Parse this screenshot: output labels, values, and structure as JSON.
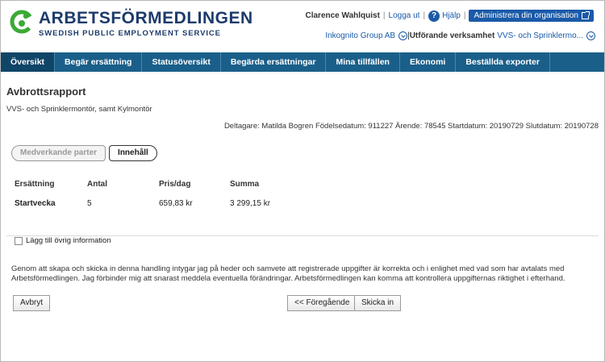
{
  "header": {
    "logo": {
      "name": "ARBETSFÖRMEDLINGEN",
      "subtitle": "SWEDISH PUBLIC EMPLOYMENT SERVICE"
    },
    "user_name": "Clarence Wahlquist",
    "logout": "Logga ut",
    "help": "Hjälp",
    "admin_button": "Administrera din organisation",
    "org_name": "Inkognito Group AB",
    "activity_label": "Utförande verksamhet",
    "activity_value": "VVS- och Sprinklermo..."
  },
  "nav": {
    "items": [
      "Översikt",
      "Begär ersättning",
      "Statusöversikt",
      "Begärda ersättningar",
      "Mina tillfällen",
      "Ekonomi",
      "Beställda exporter"
    ],
    "active_index": 0
  },
  "page": {
    "title": "Avbrottsrapport",
    "subtitle": "VVS- och Sprinklermontör, samt Kylmontör",
    "participant_info": "Deltagare: Matilda Bogren Födelsedatum: 911227 Ärende: 78545 Startdatum: 20190729 Slutdatum: 20190728"
  },
  "steps": {
    "previous": "Medverkande parter",
    "current": "Innehåll"
  },
  "table": {
    "headers": [
      "Ersättning",
      "Antal",
      "Pris/dag",
      "Summa"
    ],
    "rows": [
      [
        "Startvecka",
        "5",
        "659,83 kr",
        "3 299,15 kr"
      ]
    ]
  },
  "extra_info_label": "Lägg till övrig information",
  "declaration": "Genom att skapa och skicka in denna handling intygar jag på heder och samvete att registrerade uppgifter är korrekta och i enlighet med vad som har avtalats med Arbetsförmedlingen. Jag förbinder mig att snarast meddela eventuella förändringar. Arbetsförmedlingen kan komma att kontrollera uppgifternas riktighet i efterhand.",
  "buttons": {
    "cancel": "Avbryt",
    "previous": "<< Föregående",
    "submit": "Skicka in"
  },
  "colors": {
    "brand_blue": "#1d3b6b",
    "nav_bg": "#1a5f8a",
    "nav_active": "#0f4567",
    "link": "#1a5aa8",
    "logo_green": "#3aaa35"
  }
}
